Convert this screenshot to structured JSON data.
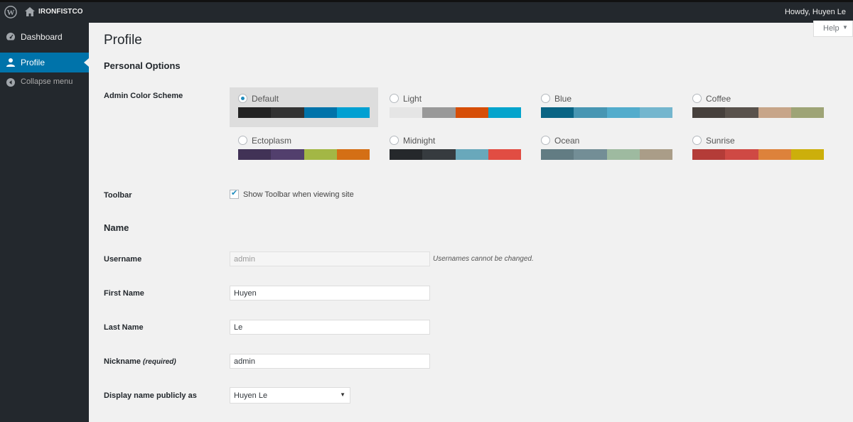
{
  "adminbar": {
    "site_name": "IRONFISTCO",
    "greeting": "Howdy, Huyen Le"
  },
  "sidebar": {
    "items": [
      {
        "label": "Dashboard",
        "icon": "dashboard-icon"
      },
      {
        "label": "Profile",
        "icon": "user-icon",
        "active": true
      },
      {
        "label": "Collapse menu",
        "icon": "collapse-icon"
      }
    ]
  },
  "help": {
    "label": "Help",
    "arrow": "▼"
  },
  "page": {
    "title": "Profile"
  },
  "personal_options": {
    "title": "Personal Options",
    "color_scheme_label": "Admin Color Scheme",
    "schemes": [
      {
        "name": "Default",
        "selected": true,
        "colors": [
          "#222222",
          "#333333",
          "#0073aa",
          "#00a0d2"
        ]
      },
      {
        "name": "Light",
        "selected": false,
        "colors": [
          "#e5e5e5",
          "#999999",
          "#d64e07",
          "#04a4cc"
        ]
      },
      {
        "name": "Blue",
        "selected": false,
        "colors": [
          "#096484",
          "#4796b3",
          "#52accc",
          "#74b6ce"
        ]
      },
      {
        "name": "Coffee",
        "selected": false,
        "colors": [
          "#46403c",
          "#59524c",
          "#c7a589",
          "#9ea476"
        ]
      },
      {
        "name": "Ectoplasm",
        "selected": false,
        "colors": [
          "#413256",
          "#523f6d",
          "#a3b745",
          "#d46f15"
        ]
      },
      {
        "name": "Midnight",
        "selected": false,
        "colors": [
          "#25282b",
          "#363b3f",
          "#69a8bb",
          "#e14d43"
        ]
      },
      {
        "name": "Ocean",
        "selected": false,
        "colors": [
          "#627c83",
          "#738e96",
          "#9ebaa0",
          "#aa9d88"
        ]
      },
      {
        "name": "Sunrise",
        "selected": false,
        "colors": [
          "#b43c38",
          "#cf4944",
          "#dd823b",
          "#ccaf0b"
        ]
      }
    ],
    "toolbar_label": "Toolbar",
    "toolbar_checkbox_label": "Show Toolbar when viewing site",
    "toolbar_checked": true
  },
  "name_section": {
    "title": "Name",
    "username_label": "Username",
    "username_value": "admin",
    "username_note": "Usernames cannot be changed.",
    "first_name_label": "First Name",
    "first_name_value": "Huyen",
    "last_name_label": "Last Name",
    "last_name_value": "Le",
    "nickname_label": "Nickname",
    "nickname_required": "(required)",
    "nickname_value": "admin",
    "display_name_label": "Display name publicly as",
    "display_name_value": "Huyen Le"
  }
}
